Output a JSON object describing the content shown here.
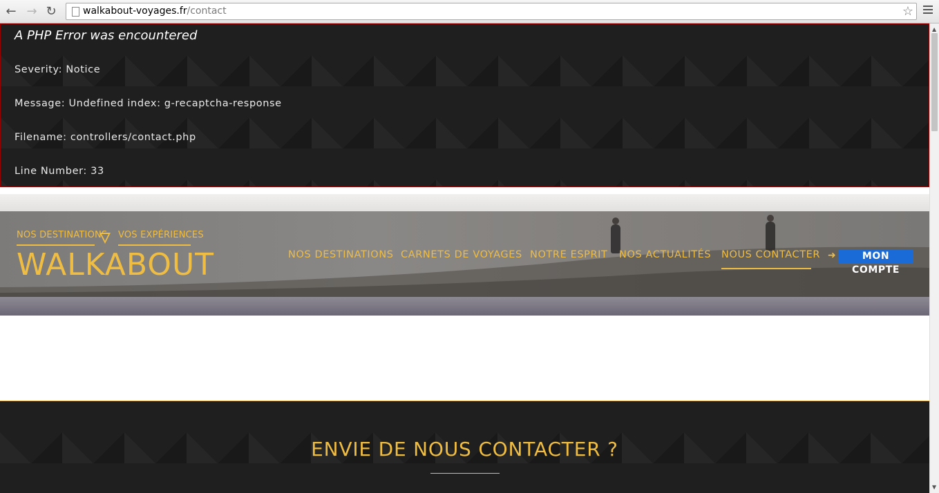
{
  "browser": {
    "url_domain": "walkabout-voyages.fr",
    "url_path": "/contact",
    "back_icon": "arrow-left-icon",
    "forward_icon": "arrow-right-icon",
    "reload_icon": "reload-icon",
    "bookmark_icon": "star-icon",
    "menu_icon": "hamburger-menu-icon"
  },
  "error": {
    "title": "A PHP Error was encountered",
    "severity": "Severity: Notice",
    "message": "Message: Undefined index: g-recaptcha-response",
    "filename": "Filename: controllers/contact.php",
    "line_number": "Line Number: 33",
    "border_color": "#990000"
  },
  "logo": {
    "left_tagline": "NOS DESTINATIONS",
    "right_tagline": "VOS EXPÉRIENCES",
    "wordmark": "WALKABOUT",
    "color": "#f0bd43"
  },
  "nav": {
    "items": [
      {
        "label": "NOS DESTINATIONS"
      },
      {
        "label": "CARNETS DE VOYAGES"
      },
      {
        "label": "NOTRE ESPRIT"
      },
      {
        "label": "NOS ACTUALITÉS"
      },
      {
        "label": "NOUS CONTACTER",
        "active": true
      }
    ],
    "account": {
      "label": "MON COMPTE",
      "icon": "sign-in-icon",
      "color": "#1a6bd8"
    }
  },
  "contact": {
    "title": "ENVIE DE NOUS CONTACTER ?"
  }
}
